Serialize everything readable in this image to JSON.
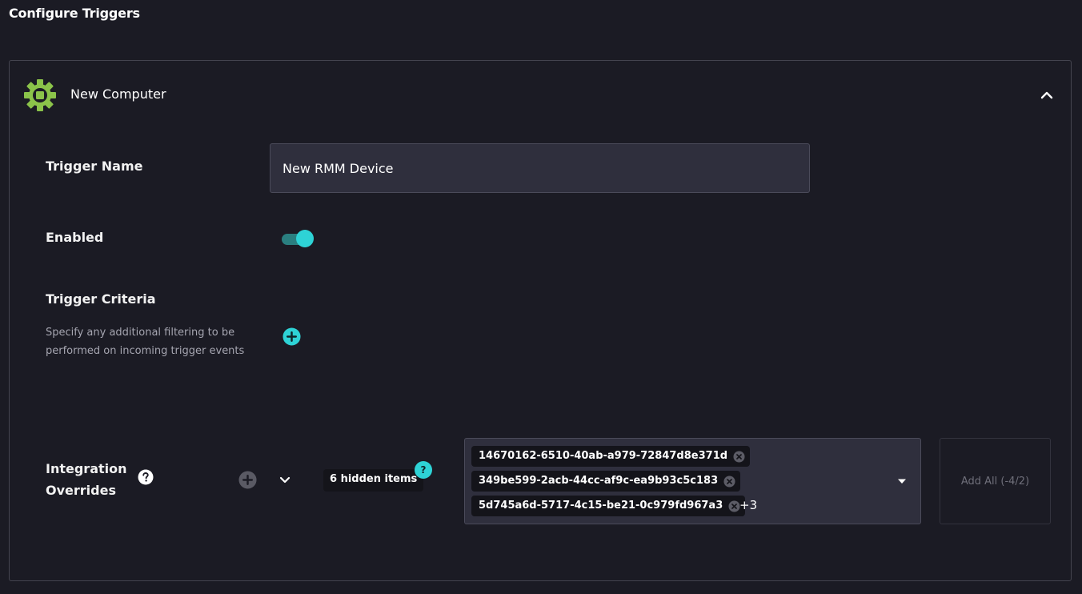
{
  "page": {
    "title": "Configure Triggers"
  },
  "trigger": {
    "name": "New Computer",
    "icon": "gear-icon",
    "icon_color": "#8bc34a",
    "collapse_icon": "chevron-up-icon"
  },
  "fields": {
    "trigger_name": {
      "label": "Trigger Name",
      "value": "New RMM Device"
    },
    "enabled": {
      "label": "Enabled",
      "checked": true
    },
    "criteria": {
      "label": "Trigger Criteria",
      "helper": "Specify any additional filtering to be performed on incoming trigger events",
      "add_icon": "plus-circle-icon"
    },
    "overrides": {
      "label": "Integration Overrides",
      "help_icon": "question-circle-icon",
      "hidden_items": "6 hidden items",
      "hidden_badge": "?",
      "selected": [
        "14670162-6510-40ab-a979-72847d8e371d",
        "349be599-2acb-44cc-af9c-ea9b93c5c183",
        "5d745a6d-5717-4c15-be21-0c979fd967a3"
      ],
      "more_count": "+3",
      "add_all": "Add All (-4/2)"
    }
  },
  "colors": {
    "background": "#1b1b24",
    "accent": "#2ed3d6",
    "input_bg": "#2f2f3d",
    "chip_bg": "#14141a"
  }
}
